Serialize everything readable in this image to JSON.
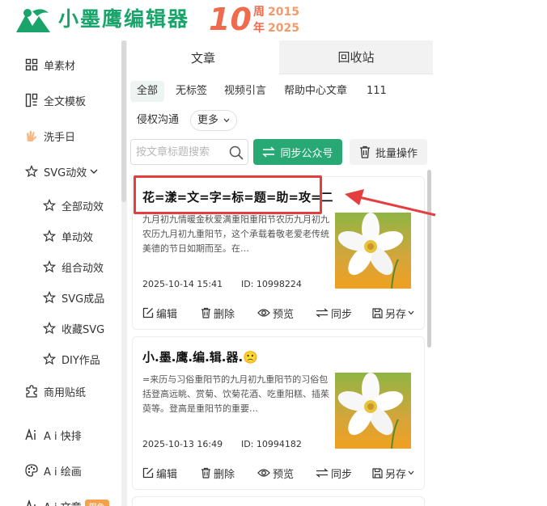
{
  "brand": {
    "name": "小墨鹰编辑器",
    "anniversary_number": "10",
    "anniversary_line1_char": "周",
    "anniversary_line1_year": "2015",
    "anniversary_line2_char": "年",
    "anniversary_line2_year": "2025",
    "accent": "#1aa36b",
    "anniv_color": "#ee6b4d"
  },
  "sidebar": {
    "items": [
      {
        "label": "单素材",
        "icon": "grid-icon"
      },
      {
        "label": "全文模板",
        "icon": "template-icon"
      },
      {
        "label": "洗手日",
        "icon": "hands-icon"
      },
      {
        "label": "SVG动效",
        "icon": "star-icon"
      },
      {
        "label": "全部动效",
        "icon": "star-icon"
      },
      {
        "label": "单动效",
        "icon": "star-icon"
      },
      {
        "label": "组合动效",
        "icon": "star-icon"
      },
      {
        "label": "SVG成品",
        "icon": "star-icon"
      },
      {
        "label": "收藏SVG",
        "icon": "star-icon"
      },
      {
        "label": "DIY作品",
        "icon": "star-icon"
      },
      {
        "label": "商用贴纸",
        "icon": "puzzle-icon"
      },
      {
        "label": "A i 快排",
        "icon": "ai-icon"
      },
      {
        "label": "A i 绘画",
        "icon": "palette-icon"
      },
      {
        "label": "A i 文章",
        "icon": "ai-doc-icon",
        "badge": "限免"
      }
    ]
  },
  "tabs": [
    {
      "label": "文章",
      "active": true
    },
    {
      "label": "回收站",
      "active": false
    }
  ],
  "filters": {
    "chips": [
      "全部",
      "无标签",
      "视频引言",
      "帮助中心文章",
      "111",
      "侵权沟通"
    ],
    "more_label": "更多"
  },
  "search": {
    "placeholder": "按文章标题搜索"
  },
  "toolbar": {
    "sync_label": "同步公众号",
    "batch_label": "批量操作",
    "sync_color": "#27a874"
  },
  "articles": [
    {
      "title": "花=漾=文=字=标=题=助=攻=二",
      "desc": "九月初九情暖金秋爱满重阳重阳节农历九月初九农历九月初九重阳节，这个承载着敬老爱老传统美德的节日如期而至。在…",
      "date": "2025-10-14 15:41",
      "id": "ID: 10998224"
    },
    {
      "title": "小.墨.鹰.编.辑.器.🙁",
      "desc": "=来历与习俗重阳节的九月初九重阳节的习俗包括登高远眺、赏菊、饮菊花酒、吃重阳糕、插茱萸等。登高是重阳节的重要…",
      "date": "2025-10-13 16:49",
      "id": "ID: 10994182"
    }
  ],
  "card_actions": {
    "edit": "编辑",
    "delete": "删除",
    "preview": "预览",
    "sync": "同步",
    "save_as": "另存"
  },
  "annotation_color": "#e53e3e"
}
